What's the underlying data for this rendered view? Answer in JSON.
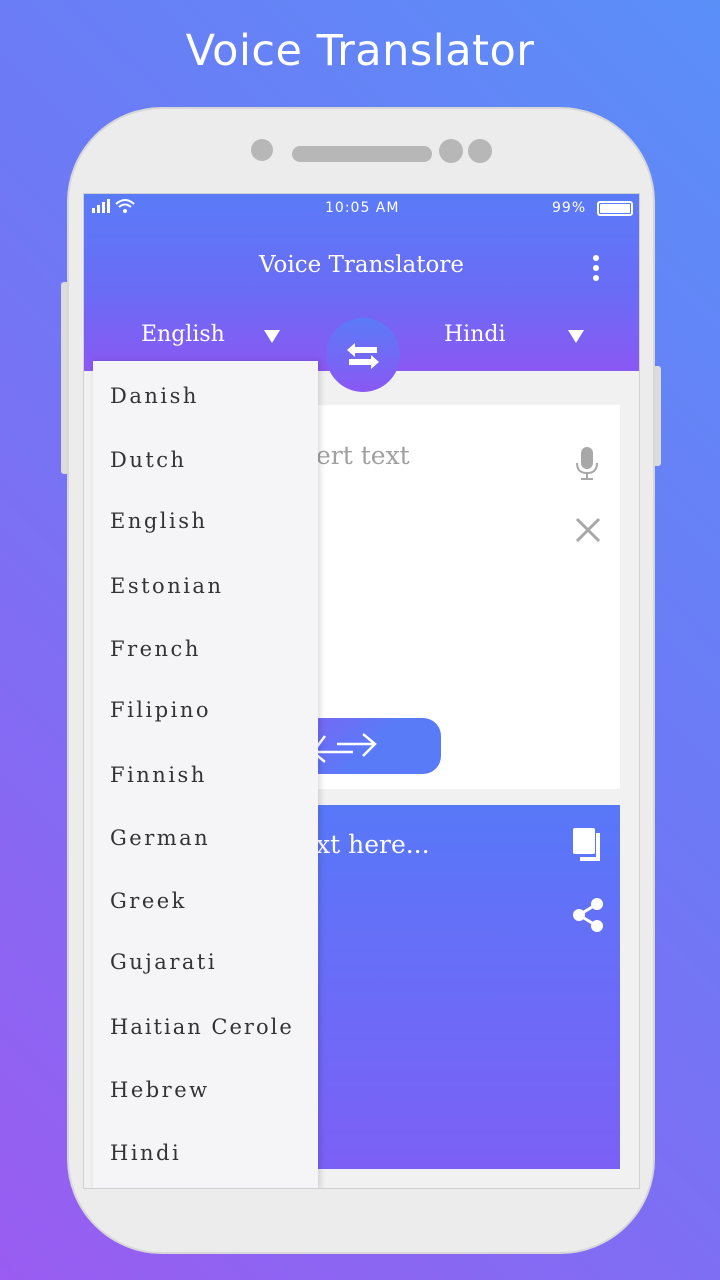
{
  "promo_title": "Voice Translator",
  "status": {
    "time": "10:05 AM",
    "battery": "99%"
  },
  "app": {
    "title": "Voice Translatore",
    "source_lang": "English",
    "target_lang": "Hindi"
  },
  "input": {
    "placeholder_visible": "ert text"
  },
  "output": {
    "placeholder_visible": "xt here..."
  },
  "dropdown": {
    "items": [
      "Danish",
      "Dutch",
      "English",
      "Estonian",
      "French",
      "Filipino",
      "Finnish",
      "German",
      "Greek",
      "Gujarati",
      "Haitian Cerole",
      "Hebrew",
      "Hindi"
    ]
  },
  "colors": {
    "header_top": "#5a7bf8",
    "header_bottom": "#8a58f3",
    "icon_gray": "#a8a8a8"
  }
}
